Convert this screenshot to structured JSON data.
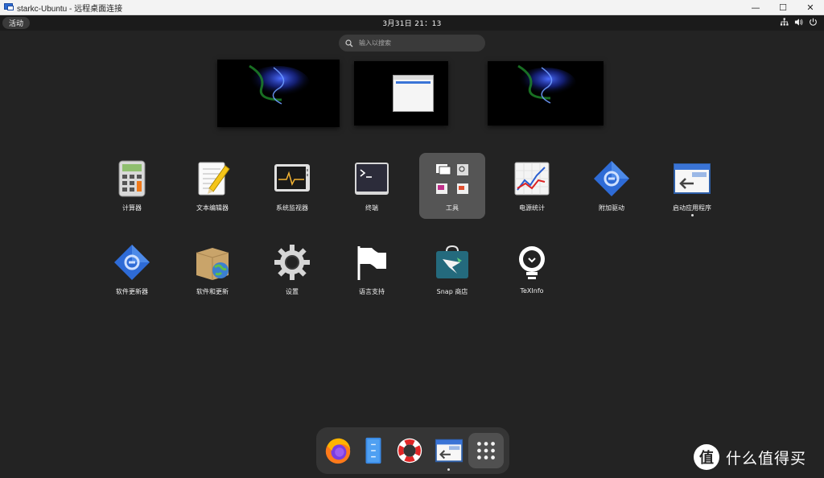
{
  "window": {
    "title": "starkc-Ubuntu - 远程桌面连接",
    "controls": {
      "minimize": "—",
      "maximize": "☐",
      "close": "✕"
    }
  },
  "topbar": {
    "activities": "活动",
    "clock": "3月31日  21：13",
    "tray_icons": [
      "network-icon",
      "volume-icon",
      "power-icon"
    ]
  },
  "search": {
    "placeholder": "输入以搜索"
  },
  "apps_row1": [
    {
      "label": "计算器",
      "icon": "calculator-icon"
    },
    {
      "label": "文本编辑器",
      "icon": "text-editor-icon"
    },
    {
      "label": "系统监视器",
      "icon": "system-monitor-icon"
    },
    {
      "label": "终端",
      "icon": "terminal-icon"
    },
    {
      "label": "工具",
      "icon": "tools-folder-icon",
      "highlighted": true
    },
    {
      "label": "电源统计",
      "icon": "power-statistics-icon"
    },
    {
      "label": "附加驱动",
      "icon": "additional-drivers-icon"
    },
    {
      "label": "启动应用程序",
      "icon": "startup-applications-icon",
      "running": true
    }
  ],
  "apps_row2": [
    {
      "label": "软件更新器",
      "icon": "software-updater-icon"
    },
    {
      "label": "软件和更新",
      "icon": "software-updates-icon"
    },
    {
      "label": "设置",
      "icon": "settings-gear-icon"
    },
    {
      "label": "语言支持",
      "icon": "language-support-flag-icon"
    },
    {
      "label": "Snap 商店",
      "icon": "snap-store-icon"
    },
    {
      "label": "TeXInfo",
      "icon": "texinfo-bulb-icon"
    }
  ],
  "dock": [
    "firefox-icon",
    "files-icon",
    "help-lifebuoy-icon",
    "startup-applications-icon",
    "show-apps-grid-icon"
  ],
  "watermark": {
    "glyph": "值",
    "text": "什么值得买"
  },
  "colors": {
    "background": "#232323",
    "topbar": "#1b1b1b",
    "highlight": "#555555",
    "accent": "#3a74d6"
  }
}
